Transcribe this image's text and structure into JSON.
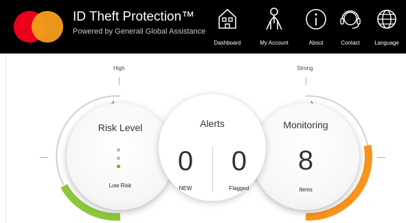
{
  "header": {
    "title": "ID Theft Protection™",
    "subtitle": "Powered by Generali Global Assistance",
    "nav": [
      {
        "label": "Dashboard",
        "icon": "house-icon"
      },
      {
        "label": "My Account",
        "icon": "person-icon"
      },
      {
        "label": "About",
        "icon": "info-icon"
      },
      {
        "label": "Contact",
        "icon": "headset-icon"
      },
      {
        "label": "Language",
        "icon": "globe-icon"
      }
    ]
  },
  "dashboard": {
    "risk_scale_label": "High",
    "monitoring_scale_label": "Strong",
    "risk": {
      "title": "Risk Level",
      "status": "Low Risk",
      "level_color": "#8dc63f"
    },
    "alerts": {
      "title": "Alerts",
      "new_count": "0",
      "new_label": "NEW",
      "flagged_count": "0",
      "flagged_label": "Flagged"
    },
    "monitoring": {
      "title": "Monitoring",
      "count": "8",
      "count_label": "Items",
      "level_color": "#f7941d"
    }
  },
  "colors": {
    "header_bg": "#000000",
    "mastercard_red": "#eb001b",
    "mastercard_orange": "#f79e1b"
  }
}
